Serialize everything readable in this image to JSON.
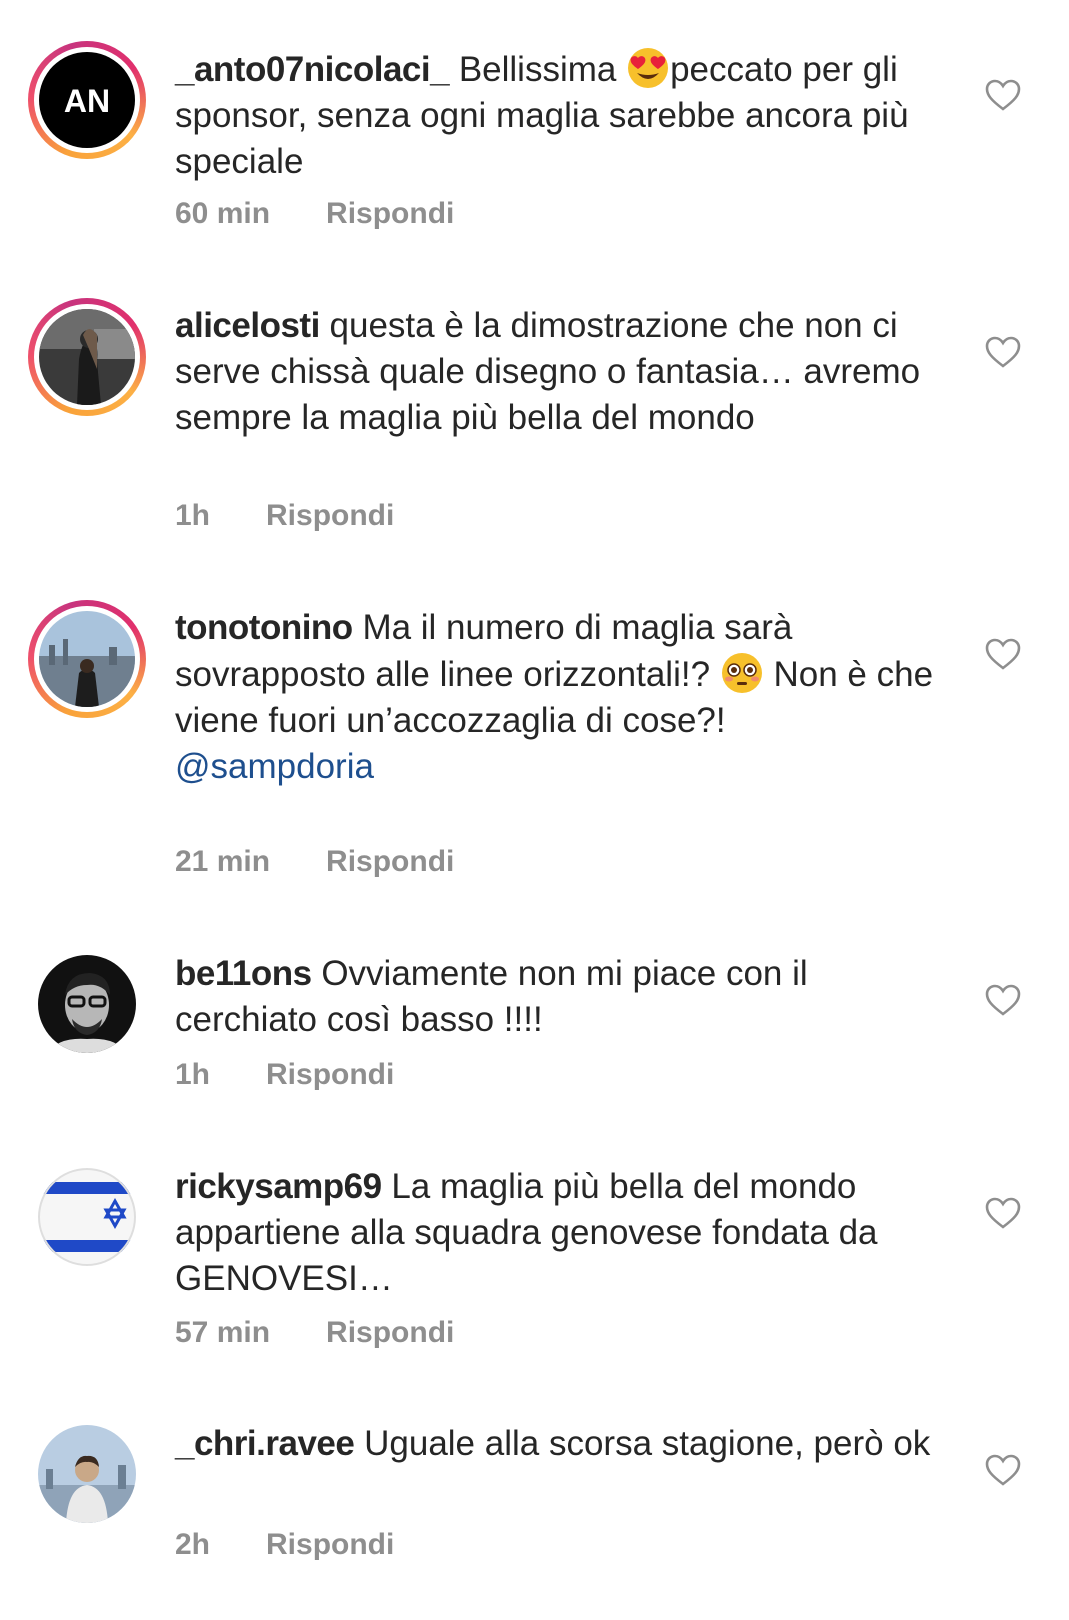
{
  "comments": [
    {
      "username": "_anto07nicolaci_",
      "text_before_emoji": "Bellissima ",
      "emoji": "heart-eyes-emoji",
      "text_after_emoji": "peccato per gli sponsor, senza ogni maglia sarebbe ancora più speciale",
      "time": "60 min",
      "reply_label": "Rispondi",
      "avatar_initials": "AN"
    },
    {
      "username": "alicelosti",
      "text": "questa è la dimostrazione che non ci serve chissà quale disegno o fantasia… avremo sempre la maglia più bella del mondo",
      "time": "1h",
      "reply_label": "Rispondi"
    },
    {
      "username": "tonotonino",
      "text_before_emoji": "Ma il numero di maglia sarà sovrapposto alle linee orizzontali!? ",
      "emoji": "flushed-face-emoji",
      "text_after_emoji": " Non è che viene fuori un’accozzaglia di cose?!",
      "mention": "@sampdoria",
      "time": "21 min",
      "reply_label": "Rispondi"
    },
    {
      "username": "be11ons",
      "text": "Ovviamente non mi piace con il cerchiato così basso !!!!",
      "time": "1h",
      "reply_label": "Rispondi"
    },
    {
      "username": "rickysamp69",
      "text": "La maglia più bella del mondo appartiene alla squadra genovese fondata da GENOVESI…",
      "time": "57 min",
      "reply_label": "Rispondi"
    },
    {
      "username": "_chri.ravee",
      "text": "Uguale alla scorsa stagione, però ok",
      "time": "2h",
      "reply_label": "Rispondi"
    }
  ],
  "colors": {
    "text": "#262626",
    "meta": "#8e8e8e",
    "mention": "#1e4f8e",
    "heart": "#8e8e8e"
  }
}
